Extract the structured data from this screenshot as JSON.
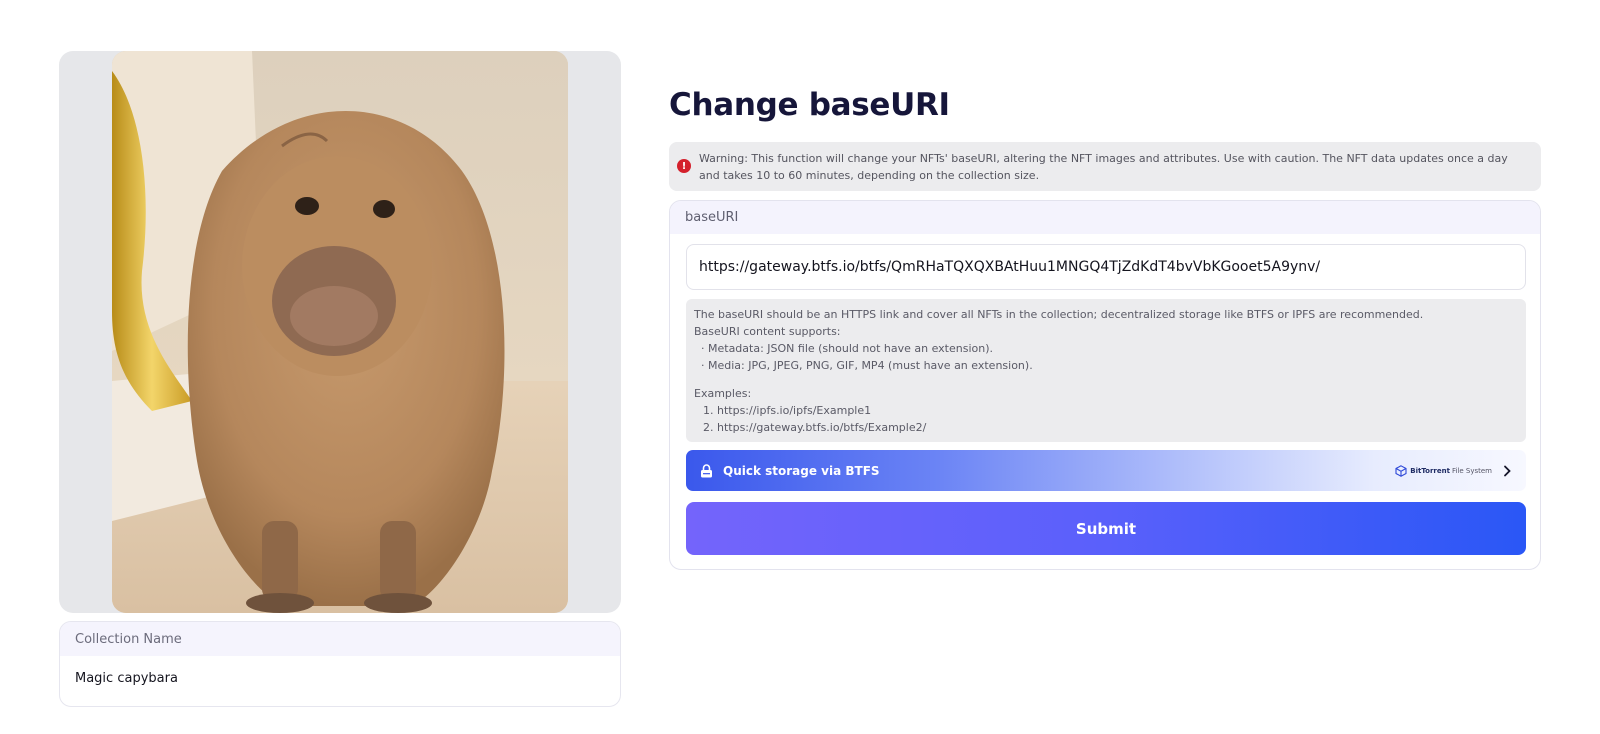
{
  "preview": {
    "image_alt": "Capybara photo"
  },
  "collection": {
    "label": "Collection Name",
    "value": "Magic capybara"
  },
  "page": {
    "title": "Change baseURI"
  },
  "warning": {
    "text": "Warning: This function will change your NFTs' baseURI, altering the NFT images and attributes. Use with caution. The NFT data updates once a day and takes 10 to 60 minutes, depending on the collection size."
  },
  "form": {
    "label": "baseURI",
    "input_value": "https://gateway.btfs.io/btfs/QmRHaTQXQXBAtHuu1MNGQ4TjZdKdT4bvVbKGooet5A9ynv/",
    "help": {
      "line1": "The baseURI should be an HTTPS link and cover all NFTs in the collection; decentralized storage like BTFS or IPFS are recommended.",
      "line2": "BaseURI content supports:",
      "bullet1": "· Metadata: JSON file (should not have an extension).",
      "bullet2": "· Media: JPG, JPEG, PNG, GIF, MP4 (must have an extension).",
      "examples_label": "Examples:",
      "example1": "1. https://ipfs.io/ipfs/Example1",
      "example2": "2. https://gateway.btfs.io/btfs/Example2/"
    },
    "quick_storage": {
      "label": "Quick storage via BTFS",
      "brand_name": "BitTorrent",
      "brand_suffix": "File System"
    },
    "submit_label": "Submit"
  },
  "colors": {
    "accent": "#5a60fb",
    "warning_icon": "#d4202c",
    "title": "#16163a"
  },
  "icons": {
    "warning": "exclamation-circle-icon",
    "quick_storage": "lock-icon",
    "brand": "btfs-cube-icon",
    "arrow": "chevron-right-icon"
  }
}
